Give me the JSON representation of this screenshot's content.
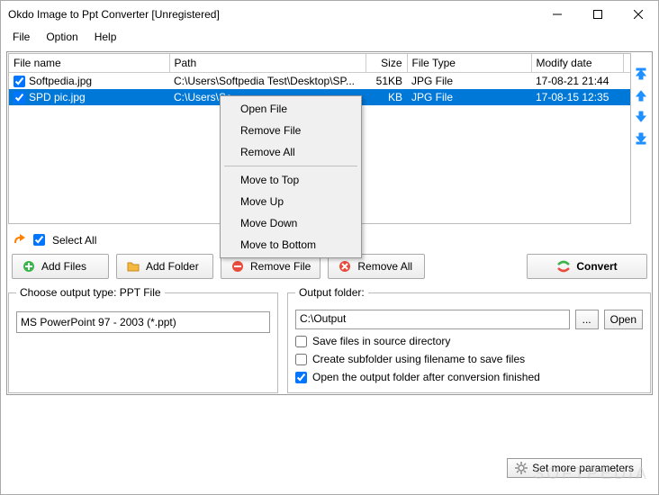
{
  "window": {
    "title": "Okdo Image to Ppt Converter [Unregistered]"
  },
  "menu": {
    "file": "File",
    "option": "Option",
    "help": "Help"
  },
  "columns": {
    "name": "File name",
    "path": "Path",
    "size": "Size",
    "type": "File Type",
    "modify": "Modify date"
  },
  "rows": [
    {
      "checked": true,
      "name": "Softpedia.jpg",
      "path": "C:\\Users\\Softpedia Test\\Desktop\\SP...",
      "size": "51KB",
      "type": "JPG File",
      "modify": "17-08-21 21:44",
      "selected": false
    },
    {
      "checked": true,
      "name": "SPD pic.jpg",
      "path": "C:\\Users\\So",
      "size": "KB",
      "type": "JPG File",
      "modify": "17-08-15 12:35",
      "selected": true
    }
  ],
  "context_menu": {
    "open": "Open File",
    "remove": "Remove File",
    "remove_all": "Remove All",
    "move_top": "Move to Top",
    "move_up": "Move Up",
    "move_down": "Move Down",
    "move_bottom": "Move to Bottom"
  },
  "sel_all": {
    "label": "Select All",
    "checked": true
  },
  "buttons": {
    "add_files": "Add Files",
    "add_folder": "Add Folder",
    "remove_file": "Remove File",
    "remove_all": "Remove All",
    "convert": "Convert"
  },
  "output_type": {
    "legend": "Choose output type:  PPT File",
    "value": "MS PowerPoint 97 - 2003 (*.ppt)"
  },
  "output_folder": {
    "legend": "Output folder:",
    "value": "C:\\Output",
    "browse": "...",
    "open": "Open",
    "opt_source": "Save files in source directory",
    "opt_subfolder": "Create subfolder using filename to save files",
    "opt_open_after": "Open the output folder after conversion finished",
    "opt_source_checked": false,
    "opt_subfolder_checked": false,
    "opt_open_after_checked": true,
    "set_params": "Set more parameters"
  },
  "watermark": "SOFTPEDIA"
}
